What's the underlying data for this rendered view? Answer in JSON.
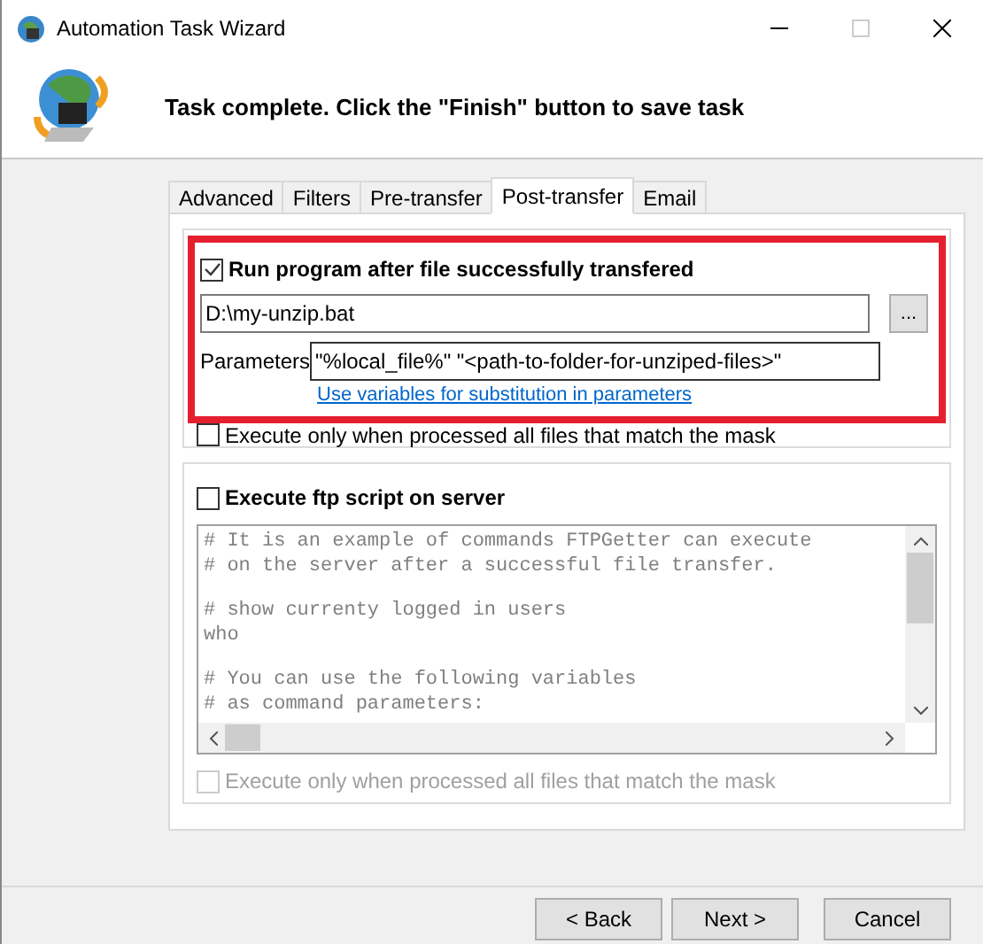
{
  "window": {
    "title": "Automation Task Wizard"
  },
  "header": {
    "message": "Task complete. Click the \"Finish\" button to save task"
  },
  "tabs": [
    {
      "label": "Advanced",
      "selected": false
    },
    {
      "label": "Filters",
      "selected": false
    },
    {
      "label": "Pre-transfer",
      "selected": false
    },
    {
      "label": "Post-transfer",
      "selected": true
    },
    {
      "label": "Email",
      "selected": false
    }
  ],
  "run_program": {
    "label": "Run program after file successfully transfered",
    "checked": true,
    "highlighted": true,
    "path": "D:\\my-unzip.bat",
    "browse": "...",
    "parameters_label": "Parameters",
    "parameters": "\"%local_file%\" \"<path-to-folder-for-unziped-files>\"",
    "link": "Use variables for substitution in parameters"
  },
  "run_program_mask": {
    "label": "Execute only when processed all files that match the mask",
    "checked": false,
    "disabled": false
  },
  "ftp_script": {
    "label": "Execute ftp script on server",
    "checked": false,
    "blocks": [
      [
        "# It is an example of commands FTPGetter can execute",
        "# on the server after a successful file transfer."
      ],
      [
        "# show currenty logged in users",
        "who"
      ],
      [
        "# You can use the following variables",
        "# as command parameters:"
      ]
    ]
  },
  "ftp_mask": {
    "label": "Execute only when processed all files that match the mask",
    "checked": false,
    "disabled": true
  },
  "buttons": [
    {
      "label": "< Back"
    },
    {
      "label": "Next >"
    },
    {
      "label": "Cancel"
    }
  ]
}
